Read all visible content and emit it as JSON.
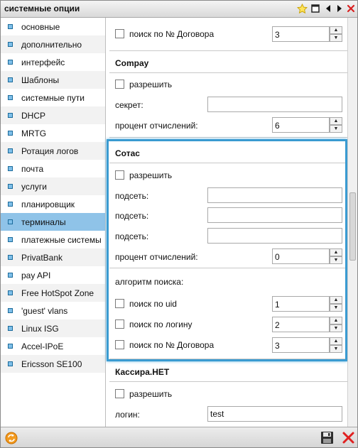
{
  "window": {
    "title": "системные опции"
  },
  "sidebar": {
    "items": [
      {
        "label": "основные"
      },
      {
        "label": "дополнительно"
      },
      {
        "label": "интерфейс"
      },
      {
        "label": "Шаблоны"
      },
      {
        "label": "системные пути"
      },
      {
        "label": "DHCP"
      },
      {
        "label": "MRTG"
      },
      {
        "label": "Ротация логов"
      },
      {
        "label": "почта"
      },
      {
        "label": "услуги"
      },
      {
        "label": "планировщик"
      },
      {
        "label": "терминалы",
        "active": true
      },
      {
        "label": "платежные системы"
      },
      {
        "label": "PrivatBank"
      },
      {
        "label": "pay API"
      },
      {
        "label": "Free HotSpot Zone"
      },
      {
        "label": "'guest' vlans"
      },
      {
        "label": "Linux ISG"
      },
      {
        "label": "Accel-IPoE"
      },
      {
        "label": "Ericsson SE100"
      }
    ]
  },
  "prev_section": {
    "row_label": "поиск по № Договора",
    "row_value": "3"
  },
  "compay": {
    "title": "Compay",
    "allow_label": "разрешить",
    "secret_label": "секрет:",
    "secret_value": "",
    "percent_label": "процент отчислений:",
    "percent_value": "6"
  },
  "sotas": {
    "title": "Сотас",
    "allow_label": "разрешить",
    "subnet_label": "подсеть:",
    "subnets": [
      "",
      "",
      ""
    ],
    "percent_label": "процент отчислений:",
    "percent_value": "0",
    "algo_label": "алгоритм поиска:",
    "search": [
      {
        "label": "поиск по uid",
        "value": "1"
      },
      {
        "label": "поиск по логину",
        "value": "2"
      },
      {
        "label": "поиск по № Договора",
        "value": "3"
      }
    ]
  },
  "kassira": {
    "title": "Кассира.НЕТ",
    "allow_label": "разрешить",
    "login_label": "логин:",
    "login_value": "test"
  },
  "colors": {
    "accent": "#3a9bd1",
    "active_item": "#8fc3e8"
  }
}
